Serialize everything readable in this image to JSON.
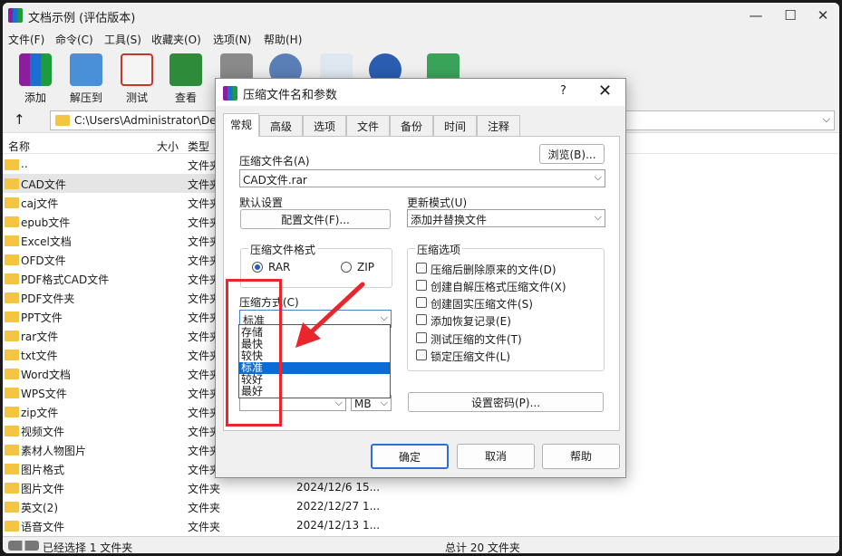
{
  "app": {
    "title": "文档示例 (评估版本)"
  },
  "window_controls": {
    "minimize": "—",
    "maximize": "☐",
    "close": "✕"
  },
  "menu": [
    "文件(F)",
    "命令(C)",
    "工具(S)",
    "收藏夹(O)",
    "选项(N)",
    "帮助(H)"
  ],
  "toolbar": {
    "add": "添加",
    "extract": "解压到",
    "test": "测试",
    "view": "查看"
  },
  "address": {
    "path": "C:\\Users\\Administrator\\Des"
  },
  "list_header": {
    "name": "名称",
    "size": "大小",
    "type": "类型"
  },
  "files": [
    {
      "name": "..",
      "type": "文件夹",
      "date": ""
    },
    {
      "name": "CAD文件",
      "type": "文件夹",
      "date": ""
    },
    {
      "name": "caj文件",
      "type": "文件夹",
      "date": ""
    },
    {
      "name": "epub文件",
      "type": "文件夹",
      "date": ""
    },
    {
      "name": "Excel文档",
      "type": "文件夹",
      "date": ""
    },
    {
      "name": "OFD文件",
      "type": "文件夹",
      "date": ""
    },
    {
      "name": "PDF格式CAD文件",
      "type": "文件夹",
      "date": ""
    },
    {
      "name": "PDF文件夹",
      "type": "文件夹",
      "date": ""
    },
    {
      "name": "PPT文件",
      "type": "文件夹",
      "date": ""
    },
    {
      "name": "rar文件",
      "type": "文件夹",
      "date": ""
    },
    {
      "name": "txt文件",
      "type": "文件夹",
      "date": ""
    },
    {
      "name": "Word文档",
      "type": "文件夹",
      "date": ""
    },
    {
      "name": "WPS文件",
      "type": "文件夹",
      "date": ""
    },
    {
      "name": "zip文件",
      "type": "文件夹",
      "date": ""
    },
    {
      "name": "视频文件",
      "type": "文件夹",
      "date": ""
    },
    {
      "name": "素材人物图片",
      "type": "文件夹",
      "date": ""
    },
    {
      "name": "图片格式",
      "type": "文件夹",
      "date": ""
    },
    {
      "name": "图片文件",
      "type": "文件夹",
      "date": "2024/12/6 15..."
    },
    {
      "name": "英文(2)",
      "type": "文件夹",
      "date": "2022/12/27 1..."
    },
    {
      "name": "语音文件",
      "type": "文件夹",
      "date": "2024/12/13 1..."
    }
  ],
  "status": {
    "left": "已经选择 1 文件夹",
    "right": "总计 20 文件夹"
  },
  "dialog": {
    "title": "压缩文件名和参数",
    "help": "?",
    "close": "✕",
    "tabs": [
      "常规",
      "高级",
      "选项",
      "文件",
      "备份",
      "时间",
      "注释"
    ],
    "archive_name_label": "压缩文件名(A)",
    "browse": "浏览(B)...",
    "archive_name_value": "CAD文件.rar",
    "default_settings_label": "默认设置",
    "profiles_button": "配置文件(F)...",
    "update_mode_label": "更新模式(U)",
    "update_mode_value": "添加并替换文件",
    "format_group": "压缩文件格式",
    "format_rar": "RAR",
    "format_zip": "ZIP",
    "method_label": "压缩方式(C)",
    "method_value": "标准",
    "method_options": [
      "存储",
      "最快",
      "较快",
      "标准",
      "较好",
      "最好"
    ],
    "method_selected_index": 3,
    "split_unit": "MB",
    "options_group": "压缩选项",
    "options": [
      "压缩后删除原来的文件(D)",
      "创建自解压格式压缩文件(X)",
      "创建固实压缩文件(S)",
      "添加恢复记录(E)",
      "测试压缩的文件(T)",
      "锁定压缩文件(L)"
    ],
    "set_password": "设置密码(P)...",
    "ok": "确定",
    "cancel": "取消",
    "help_button": "帮助"
  },
  "colors": {
    "highlight": "#0b6cd6",
    "annotation_red": "#e8262c",
    "folder": "#f4c542"
  }
}
